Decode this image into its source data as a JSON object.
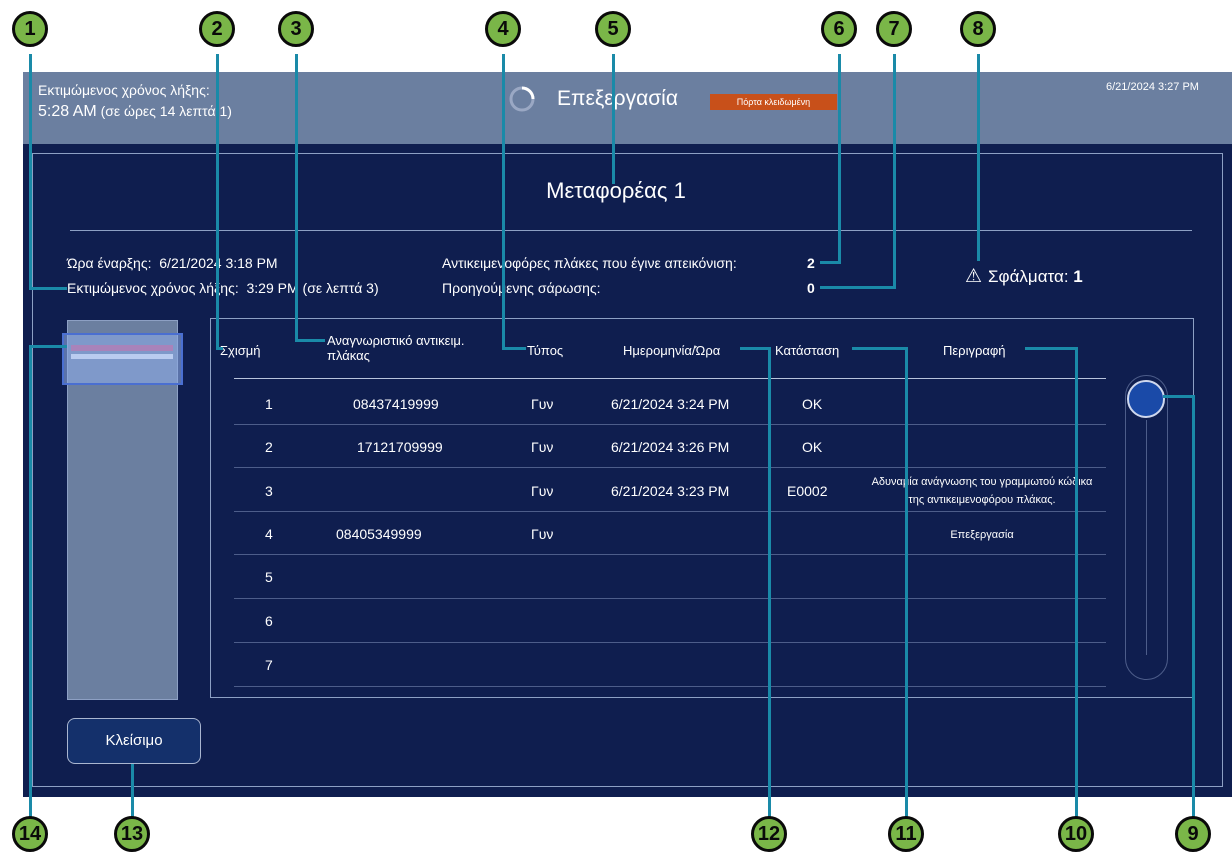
{
  "header": {
    "est_label": "Εκτιμώμενος χρόνος λήξης:",
    "est_time": "5:28 AM",
    "est_remaining": "(σε ώρες 14 λεπτά 1)",
    "title": "Επεξεργασία",
    "badge": "Πόρτα κλειδωμένη",
    "datetime": "6/21/2024 3:27 PM"
  },
  "conveyor": {
    "title": "Μεταφορέας 1",
    "start_label": "Ώρα έναρξης:",
    "start_value": "6/21/2024 3:18 PM",
    "end_label": "Εκτιμώμενος χρόνος λήξης:",
    "end_value": "3:29 PM",
    "end_remaining": "(σε λεπτά 3)",
    "imaged_label": "Αντικειμενοφόρες πλάκες που έγινε απεικόνιση:",
    "imaged_value": "2",
    "prev_scan_label": "Προηγούμενης σάρωσης:",
    "prev_scan_value": "0",
    "errors_label": "Σφάλματα:",
    "errors_value": "1",
    "errors_icon": "warning-icon"
  },
  "table": {
    "headers": {
      "slot": "Σχισμή",
      "slide_id": "Αναγνωριστικό αντικειμ. πλάκας",
      "type": "Τύπος",
      "datetime": "Ημερομηνία/Ώρα",
      "status": "Κατάσταση",
      "description": "Περιγραφή"
    },
    "rows": [
      {
        "slot": "1",
        "slide_id": "08437419999",
        "type": "Γυν",
        "datetime": "6/21/2024 3:24 PM",
        "status": "OK",
        "description": ""
      },
      {
        "slot": "2",
        "slide_id": "17121709999",
        "type": "Γυν",
        "datetime": "6/21/2024 3:26 PM",
        "status": "OK",
        "description": ""
      },
      {
        "slot": "3",
        "slide_id": "",
        "type": "Γυν",
        "datetime": "6/21/2024 3:23 PM",
        "status": "E0002",
        "description": "Αδυναμία ανάγνωσης του γραμμωτού κώδικα της αντικειμενοφόρου πλάκας."
      },
      {
        "slot": "4",
        "slide_id": "08405349999",
        "type": "Γυν",
        "datetime": "",
        "status": "",
        "description": "Επεξεργασία"
      },
      {
        "slot": "5",
        "slide_id": "",
        "type": "",
        "datetime": "",
        "status": "",
        "description": ""
      },
      {
        "slot": "6",
        "slide_id": "",
        "type": "",
        "datetime": "",
        "status": "",
        "description": ""
      },
      {
        "slot": "7",
        "slide_id": "",
        "type": "",
        "datetime": "",
        "status": "",
        "description": ""
      }
    ]
  },
  "buttons": {
    "close": "Κλείσιμο"
  },
  "callouts": [
    "1",
    "2",
    "3",
    "4",
    "5",
    "6",
    "7",
    "8",
    "9",
    "10",
    "11",
    "12",
    "13",
    "14"
  ],
  "colors": {
    "background": "#0f1e4f",
    "topbar": "#6b7fa0",
    "badge": "#c8501a",
    "callout_fill": "#7ab648",
    "callout_line": "#1a8aa8",
    "slot_pink": "#d54a78"
  }
}
